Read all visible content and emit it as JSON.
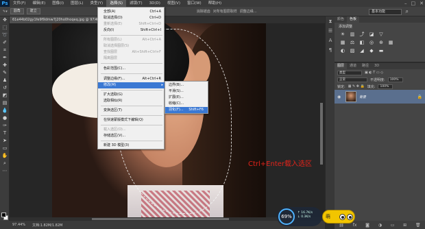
{
  "app": {
    "logo": "Ps"
  },
  "menubar": {
    "items": [
      "文件(F)",
      "编辑(E)",
      "图像(I)",
      "图层(L)",
      "类型(Y)",
      "选择(S)",
      "滤镜(T)",
      "3D(D)",
      "视图(V)",
      "窗口(W)",
      "帮助(H)"
    ],
    "active_index": 5
  },
  "window_controls": {
    "minimize": "–",
    "restore": "□",
    "close": "✕"
  },
  "options": {
    "mode": "圆角",
    "mode2": "建立",
    "tolerance_label": "消除锯齿",
    "check_label": "对所有图层取样",
    "sample_label": "调整边缘...",
    "workspace": "基本功能"
  },
  "document": {
    "tab_title": "61e44b02gy1fe9f9dmw7j20ho0hoqeq.jpg @ 97.4%...",
    "close": "×"
  },
  "select_menu": {
    "items": [
      {
        "label": "全部(A)",
        "shortcut": "Ctrl+A",
        "disabled": false
      },
      {
        "label": "取消选择(D)",
        "shortcut": "Ctrl+D",
        "disabled": false
      },
      {
        "label": "重新选择(E)",
        "shortcut": "Shift+Ctrl+D",
        "disabled": true
      },
      {
        "label": "反向(I)",
        "shortcut": "Shift+Ctrl+I",
        "disabled": false
      },
      {
        "label": "所有图层(L)",
        "shortcut": "Alt+Ctrl+A",
        "disabled": true
      },
      {
        "label": "取消选择图层(S)",
        "shortcut": "",
        "disabled": true
      },
      {
        "label": "查找图层",
        "shortcut": "Alt+Shift+Ctrl+F",
        "disabled": true
      },
      {
        "label": "隔离图层",
        "shortcut": "",
        "disabled": true
      },
      {
        "label": "色彩范围(C)...",
        "shortcut": "",
        "disabled": false
      },
      {
        "label": "调整边缘(F)...",
        "shortcut": "Alt+Ctrl+R",
        "disabled": false
      },
      {
        "label": "修改(M)",
        "shortcut": "",
        "disabled": false,
        "submenu": true
      },
      {
        "label": "扩大选取(G)",
        "shortcut": "",
        "disabled": false
      },
      {
        "label": "选取相似(R)",
        "shortcut": "",
        "disabled": false
      },
      {
        "label": "变换选区(T)",
        "shortcut": "",
        "disabled": false
      },
      {
        "label": "在快速蒙版模式下编辑(Q)",
        "shortcut": "",
        "disabled": false
      },
      {
        "label": "载入选区(O)...",
        "shortcut": "",
        "disabled": true
      },
      {
        "label": "存储选区(V)...",
        "shortcut": "",
        "disabled": false
      },
      {
        "label": "新建 3D 模型(3)",
        "shortcut": "",
        "disabled": false
      }
    ]
  },
  "modify_submenu": {
    "items": [
      {
        "label": "边界(B)...",
        "shortcut": ""
      },
      {
        "label": "平滑(S)...",
        "shortcut": ""
      },
      {
        "label": "扩展(E)...",
        "shortcut": ""
      },
      {
        "label": "收缩(C)...",
        "shortcut": ""
      },
      {
        "label": "羽化(F)...",
        "shortcut": "Shift+F6"
      }
    ],
    "highlight_index": 4
  },
  "annotation": {
    "text": "Ctrl+Enter载入选区"
  },
  "panels": {
    "adjust_tabs": [
      "颜色",
      "色板"
    ],
    "adjust_title": "添加调整",
    "layer_tabs": [
      "图层",
      "通道",
      "路径",
      "3D"
    ],
    "kind_label": "类型",
    "blend_mode": "正常",
    "opacity_label": "不透明度:",
    "opacity_value": "100%",
    "lock_label": "锁定:",
    "fill_label": "填充:",
    "fill_value": "100%",
    "layer_name": "背景"
  },
  "status": {
    "zoom": "97.44%",
    "doc_info": "文档:1.82M/1.82M"
  },
  "perf": {
    "percent": "69%",
    "line1": "↑ 16.7K/s",
    "line2": "↓ 0.3K/s"
  },
  "mascot": {
    "label": "萌"
  }
}
